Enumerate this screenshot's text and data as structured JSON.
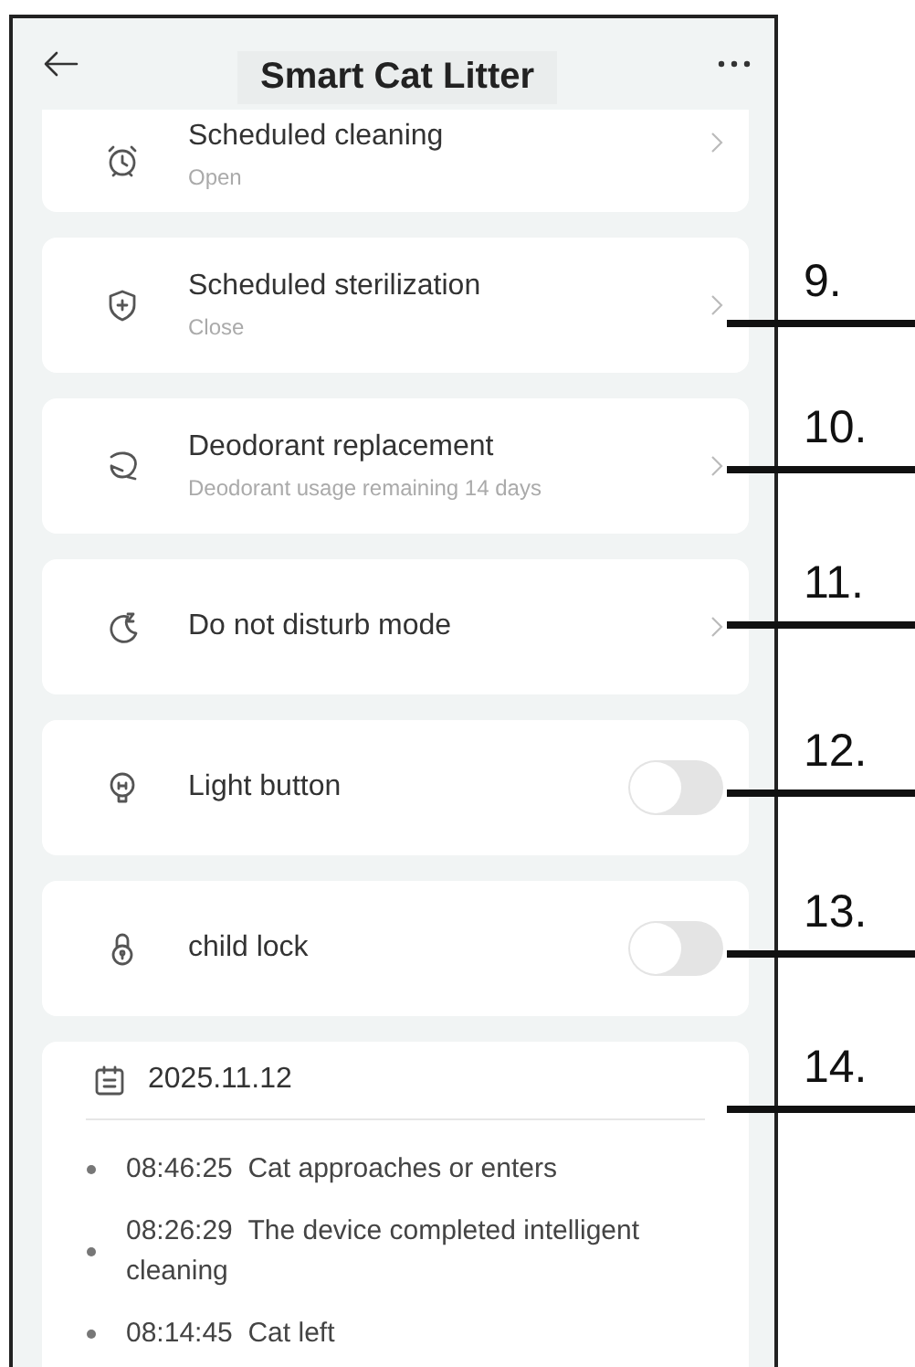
{
  "header": {
    "title": "Smart Cat Litter"
  },
  "settings": [
    {
      "kind": "link",
      "label": "Scheduled cleaning",
      "subtitle": "Open"
    },
    {
      "kind": "link",
      "label": "Scheduled sterilization",
      "subtitle": "Close"
    },
    {
      "kind": "link",
      "label": "Deodorant replacement",
      "subtitle": "Deodorant usage remaining 14 days"
    },
    {
      "kind": "link",
      "label": "Do not disturb mode"
    },
    {
      "kind": "toggle",
      "label": "Light button",
      "on": false
    },
    {
      "kind": "toggle",
      "label": "child lock",
      "on": false
    }
  ],
  "log": {
    "date": "2025.11.12",
    "entries": [
      {
        "time": "08:46:25",
        "text": "Cat approaches or enters"
      },
      {
        "time": "08:26:29",
        "text": "The device completed intelligent cleaning"
      },
      {
        "time": "08:14:45",
        "text": "Cat left"
      }
    ]
  },
  "callouts": [
    {
      "label": "9."
    },
    {
      "label": "10."
    },
    {
      "label": "11."
    },
    {
      "label": "12."
    },
    {
      "label": "13."
    },
    {
      "label": "14."
    }
  ]
}
